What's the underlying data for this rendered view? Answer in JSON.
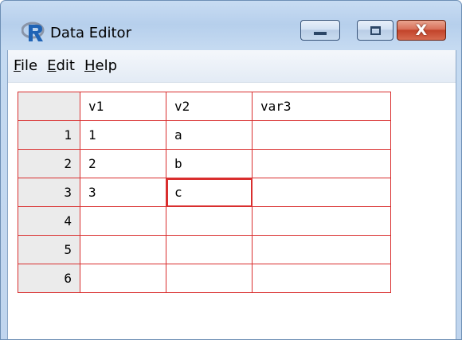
{
  "window": {
    "title": "Data Editor",
    "app_icon": "r-logo-icon",
    "controls": {
      "minimize": "minimize-icon",
      "maximize": "maximize-icon",
      "close_glyph": "X"
    }
  },
  "menu": [
    {
      "underline": "F",
      "rest": "ile"
    },
    {
      "underline": "E",
      "rest": "dit"
    },
    {
      "underline": "H",
      "rest": "elp"
    }
  ],
  "grid": {
    "columns": [
      "v1",
      "v2",
      "var3"
    ],
    "rows": [
      {
        "label": "1",
        "cells": [
          "1",
          "a",
          ""
        ]
      },
      {
        "label": "2",
        "cells": [
          "2",
          "b",
          ""
        ]
      },
      {
        "label": "3",
        "cells": [
          "3",
          "c",
          ""
        ]
      },
      {
        "label": "4",
        "cells": [
          "",
          "",
          ""
        ]
      },
      {
        "label": "5",
        "cells": [
          "",
          "",
          ""
        ]
      },
      {
        "label": "6",
        "cells": [
          "",
          "",
          ""
        ]
      }
    ],
    "selected_cell": {
      "row": 3,
      "column": "v2"
    }
  },
  "colors": {
    "grid_line": "#d92e2e",
    "header_bg": "#ebebeb",
    "close_button": "#c2432a"
  }
}
